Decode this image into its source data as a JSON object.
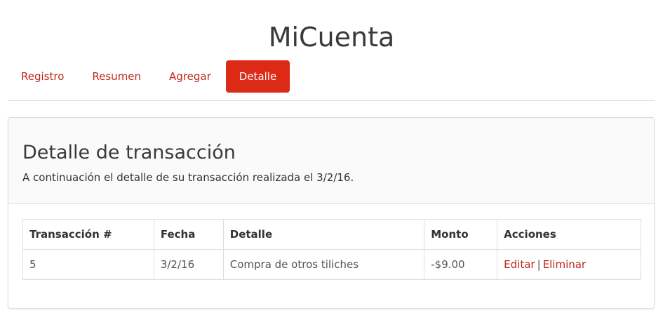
{
  "header": {
    "title": "MiCuenta"
  },
  "nav": {
    "items": [
      {
        "label": "Registro",
        "active": false
      },
      {
        "label": "Resumen",
        "active": false
      },
      {
        "label": "Agregar",
        "active": false
      },
      {
        "label": "Detalle",
        "active": true
      }
    ]
  },
  "panel": {
    "title": "Detalle de transacción",
    "description": "A continuación el detalle de su transacción realizada el 3/2/16."
  },
  "table": {
    "headers": [
      "Transacción #",
      "Fecha",
      "Detalle",
      "Monto",
      "Acciones"
    ],
    "rows": [
      {
        "id": "5",
        "date": "3/2/16",
        "detail": "Compra de otros tiliches",
        "amount": "-$9.00",
        "actions": {
          "edit": "Editar",
          "separator": "|",
          "delete": "Eliminar"
        }
      }
    ]
  },
  "colors": {
    "accent": "#dd2a16",
    "link": "#c0261c",
    "border": "#dddddd",
    "panel_header_bg": "#fafafa"
  }
}
